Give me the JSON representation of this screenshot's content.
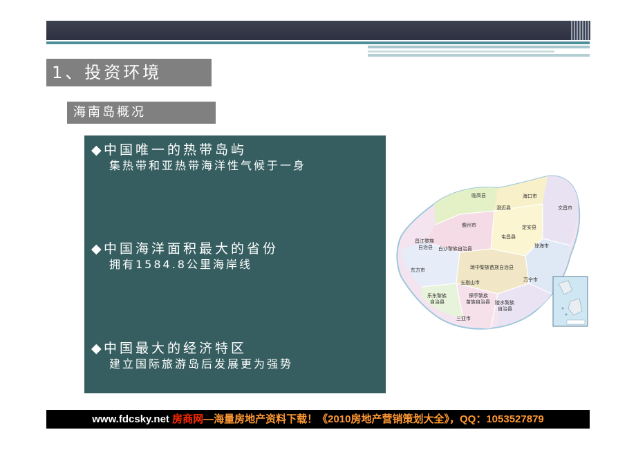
{
  "section_title": "1、投资环境",
  "subsection_title": "海南岛概况",
  "points": [
    {
      "bullet": "◆",
      "head": "中国唯一的热带岛屿",
      "sub": "集热带和亚热带海洋性气候于一身"
    },
    {
      "bullet": "◆",
      "head": "中国海洋面积最大的省份",
      "sub": "拥有1584.8公里海岸线"
    },
    {
      "bullet": "◆",
      "head": "中国最大的经济特区",
      "sub": "建立国际旅游岛后发展更为强势"
    }
  ],
  "map_labels": {
    "lingao": "临高县",
    "haikou": "海口市",
    "wenchang": "文昌市",
    "chengmai": "澄迈县",
    "danzhou": "儋州市",
    "dingan": "定安县",
    "tunchang": "屯昌县",
    "changjiang_1": "昌江黎族",
    "changjiang_2": "自治县",
    "baisha": "白沙黎族自治县",
    "qionghai": "琼海市",
    "dongfang": "东方市",
    "qiongzhong": "琼中黎族苗族自治县",
    "wuzhishan": "五指山市",
    "wanning": "万宁市",
    "ledong_1": "乐东黎族",
    "ledong_2": "自治县",
    "baoting_1": "保亭黎族",
    "baoting_2": "苗族自治县",
    "lingshui_1": "陵水黎族",
    "lingshui_2": "自治县",
    "sanya": "三亚市"
  },
  "colors": {
    "panel": "#365e60",
    "header_bar": "#3d4250",
    "footer_brand": "#ff2a00",
    "footer_ad": "#ff9933"
  },
  "footer": {
    "site": "www.fdcsky.net ",
    "brand": "房商网",
    "ad": "—海量房地产资料下载！《2010房地产营销策划大全》，QQ：1053527879"
  }
}
